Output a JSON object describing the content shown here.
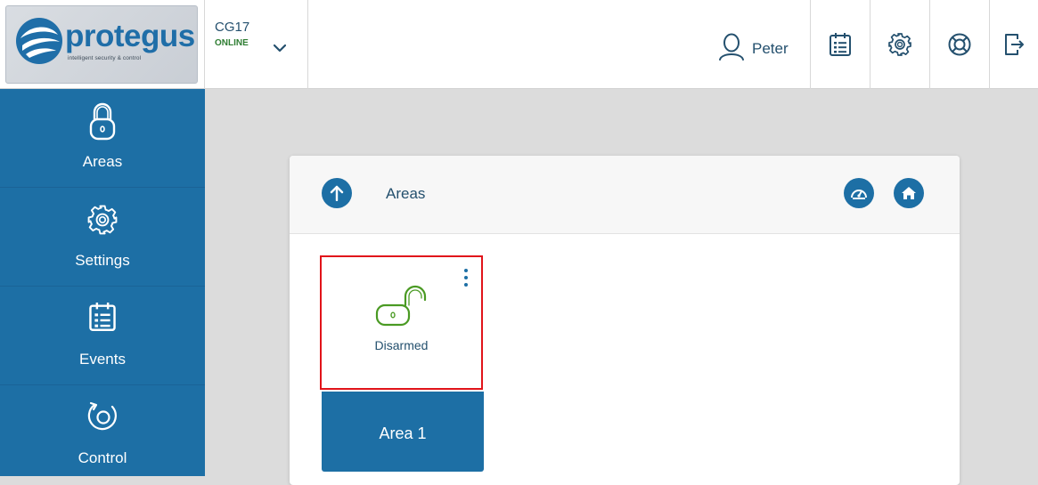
{
  "brand": {
    "name": "protegus",
    "tagline": "intelligent security & control",
    "color": "#1f6ea8"
  },
  "device": {
    "name": "CG17",
    "status": "ONLINE",
    "status_color": "#2e7d32",
    "dropdown_icon": "chevron-down-icon"
  },
  "user": {
    "name": "Peter",
    "icon": "user-icon"
  },
  "toolbar": [
    {
      "icon": "calendar-icon"
    },
    {
      "icon": "gear-icon"
    },
    {
      "icon": "lifebuoy-icon"
    },
    {
      "icon": "logout-icon"
    }
  ],
  "sidebar": {
    "color": "#1d6fa5",
    "items": [
      {
        "label": "Areas",
        "icon": "lock-icon"
      },
      {
        "label": "Settings",
        "icon": "gear-icon"
      },
      {
        "label": "Events",
        "icon": "calendar-icon"
      },
      {
        "label": "Control",
        "icon": "control-icon"
      }
    ]
  },
  "panel": {
    "title": "Areas",
    "back_icon": "arrow-up-icon",
    "actions": [
      {
        "icon": "dashboard-icon"
      },
      {
        "icon": "home-icon"
      }
    ]
  },
  "areas": [
    {
      "name": "Area 1",
      "status": "Disarmed",
      "status_icon": "unlocked-padlock-icon",
      "status_color": "#4a9a23",
      "menu_icon": "more-vertical-icon",
      "highlight_color": "#e1141a"
    }
  ]
}
